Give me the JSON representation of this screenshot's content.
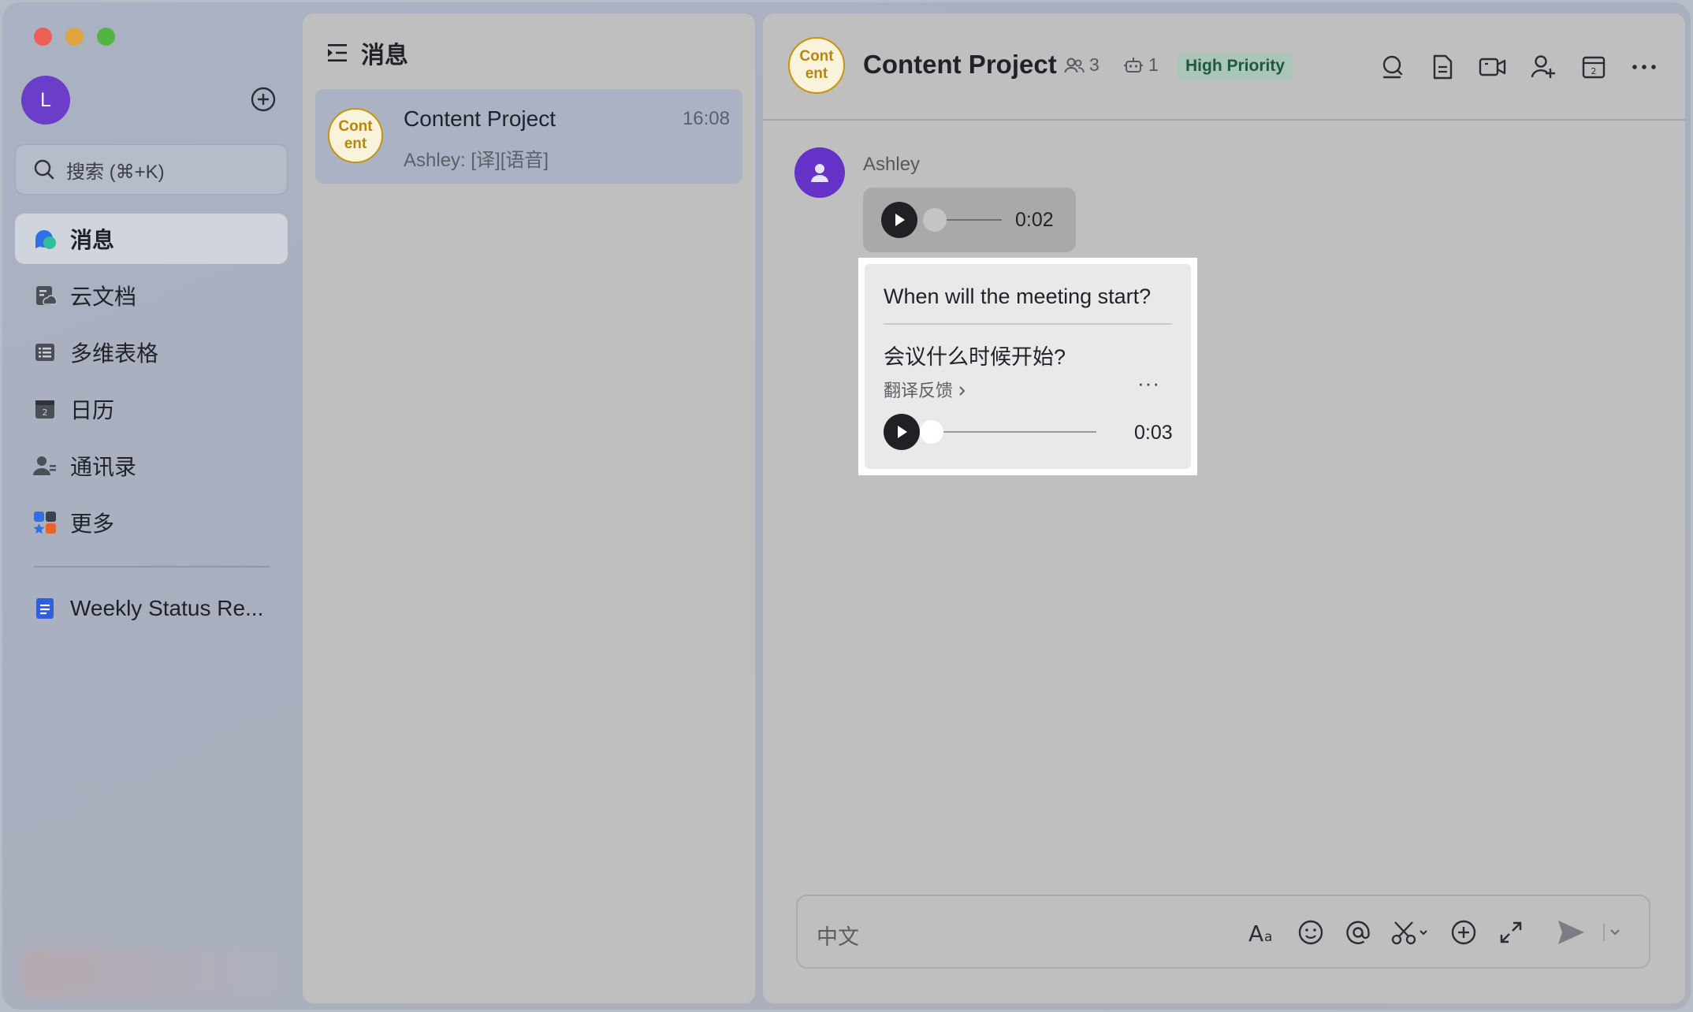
{
  "sidebar": {
    "user_initial": "L",
    "search_placeholder": "搜索 (⌘+K)",
    "nav": [
      {
        "label": "消息",
        "icon": "chat-bubble-icon",
        "active": true
      },
      {
        "label": "云文档",
        "icon": "cloud-doc-icon"
      },
      {
        "label": "多维表格",
        "icon": "table-icon"
      },
      {
        "label": "日历",
        "icon": "calendar-icon"
      },
      {
        "label": "通讯录",
        "icon": "contacts-icon"
      },
      {
        "label": "更多",
        "icon": "more-apps-icon"
      }
    ],
    "pinned": {
      "label": "Weekly Status Re...",
      "icon": "document-icon"
    }
  },
  "list": {
    "header": "消息",
    "conversation": {
      "avatar_line1": "Cont",
      "avatar_line2": "ent",
      "title": "Content Project",
      "time": "16:08",
      "preview": "Ashley: [译][语音]"
    }
  },
  "chat": {
    "avatar_line1": "Cont",
    "avatar_line2": "ent",
    "title": "Content Project",
    "members": "3",
    "bots": "1",
    "priority": "High Priority",
    "header_icons": [
      "search-chat-icon",
      "doc-icon",
      "video-call-icon",
      "add-member-icon",
      "calendar-icon",
      "more-icon"
    ],
    "message": {
      "sender": "Ashley",
      "voice_duration": "0:02",
      "translation_en": "When will the meeting start?",
      "translation_zh": "会议什么时候开始?",
      "feedback_label": "翻译反馈",
      "more_label": "···",
      "translated_voice_duration": "0:03"
    },
    "composer": {
      "placeholder": "中文"
    }
  },
  "colors": {
    "accent": "#6532c8",
    "priority_bg": "#a9c6b8",
    "priority_text": "#1d5a3f",
    "group_avatar": "#c8940c"
  }
}
